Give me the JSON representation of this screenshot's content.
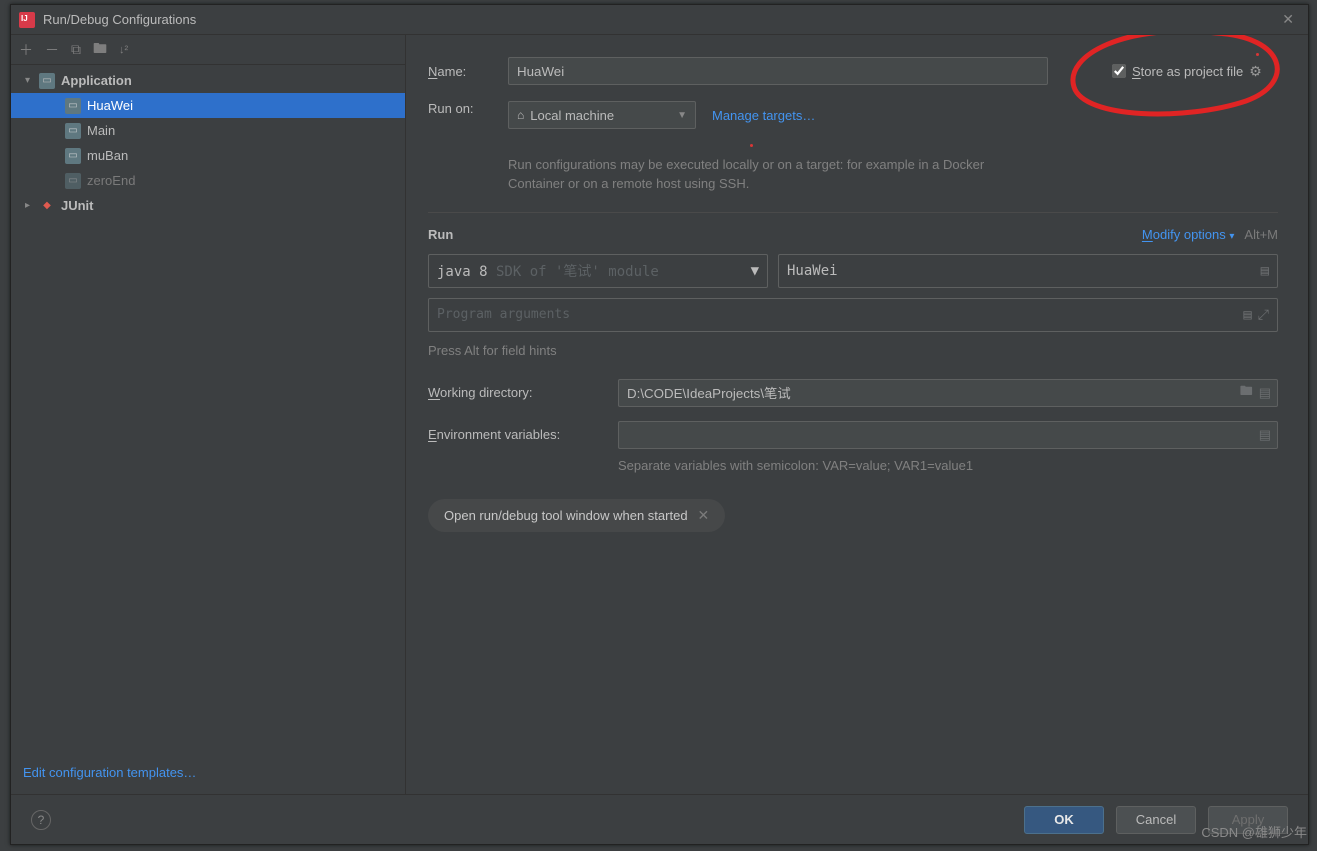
{
  "dialog": {
    "title": "Run/Debug Configurations"
  },
  "tree": {
    "application_label": "Application",
    "junit_label": "JUnit",
    "items": [
      "HuaWei",
      "Main",
      "muBan",
      "zeroEnd"
    ]
  },
  "sidebar": {
    "edit_templates": "Edit configuration templates…"
  },
  "form": {
    "name_label": "Name:",
    "name_value": "HuaWei",
    "store_label": "Store as project file",
    "store_checked": true,
    "run_on_label": "Run on:",
    "run_on_value": "Local machine",
    "manage_targets": "Manage targets…",
    "run_on_hint": "Run configurations may be executed locally or on a target: for example in a Docker Container or on a remote host using SSH.",
    "section_run": "Run",
    "modify_options": "Modify options",
    "modify_shortcut": "Alt+M",
    "jdk_prefix": "java 8",
    "jdk_suffix": " SDK of '笔试' module",
    "main_class": "HuaWei",
    "args_placeholder": "Program arguments",
    "hints_text": "Press Alt for field hints",
    "working_dir_label": "Working directory:",
    "working_dir_value": "D:\\CODE\\IdeaProjects\\笔试",
    "env_label": "Environment variables:",
    "env_value": "",
    "env_hint": "Separate variables with semicolon: VAR=value; VAR1=value1",
    "chip_text": "Open run/debug tool window when started"
  },
  "footer": {
    "ok": "OK",
    "cancel": "Cancel",
    "apply": "Apply"
  },
  "watermark": "CSDN @雄狮少年"
}
